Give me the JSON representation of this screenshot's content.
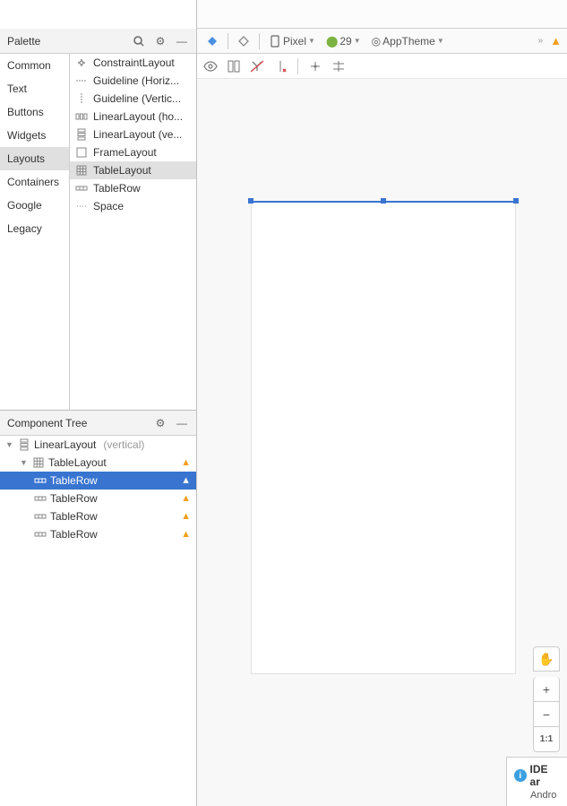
{
  "palette": {
    "title": "Palette",
    "categories": [
      "Common",
      "Text",
      "Buttons",
      "Widgets",
      "Layouts",
      "Containers",
      "Google",
      "Legacy"
    ],
    "selected_category": "Layouts",
    "widgets": [
      {
        "icon": "constraint",
        "label": "ConstraintLayout"
      },
      {
        "icon": "guideline-h",
        "label": "Guideline (Horiz..."
      },
      {
        "icon": "guideline-v",
        "label": "Guideline (Vertic..."
      },
      {
        "icon": "linear-h",
        "label": "LinearLayout (ho..."
      },
      {
        "icon": "linear-v",
        "label": "LinearLayout (ve..."
      },
      {
        "icon": "frame",
        "label": "FrameLayout"
      },
      {
        "icon": "table",
        "label": "TableLayout"
      },
      {
        "icon": "row",
        "label": "TableRow"
      },
      {
        "icon": "space",
        "label": "Space"
      }
    ],
    "selected_widget": "TableLayout"
  },
  "component_tree": {
    "title": "Component Tree",
    "items": [
      {
        "depth": 0,
        "icon": "linear-v",
        "label": "LinearLayout",
        "hint": "(vertical)",
        "arrow": true,
        "warning": false
      },
      {
        "depth": 1,
        "icon": "table",
        "label": "TableLayout",
        "hint": "",
        "arrow": true,
        "warning": true
      },
      {
        "depth": 2,
        "icon": "row",
        "label": "TableRow",
        "hint": "",
        "arrow": false,
        "warning": true,
        "selected": true
      },
      {
        "depth": 2,
        "icon": "row",
        "label": "TableRow",
        "hint": "",
        "arrow": false,
        "warning": true
      },
      {
        "depth": 2,
        "icon": "row",
        "label": "TableRow",
        "hint": "",
        "arrow": false,
        "warning": true
      },
      {
        "depth": 2,
        "icon": "row",
        "label": "TableRow",
        "hint": "",
        "arrow": false,
        "warning": true
      }
    ]
  },
  "design_toolbar": {
    "device": "Pixel",
    "api": "29",
    "theme": "AppTheme"
  },
  "float": {
    "pan": "✋",
    "plus": "+",
    "minus": "−",
    "ratio": "1:1"
  },
  "popup": {
    "title": "IDE ar",
    "subtitle": "Andro"
  }
}
